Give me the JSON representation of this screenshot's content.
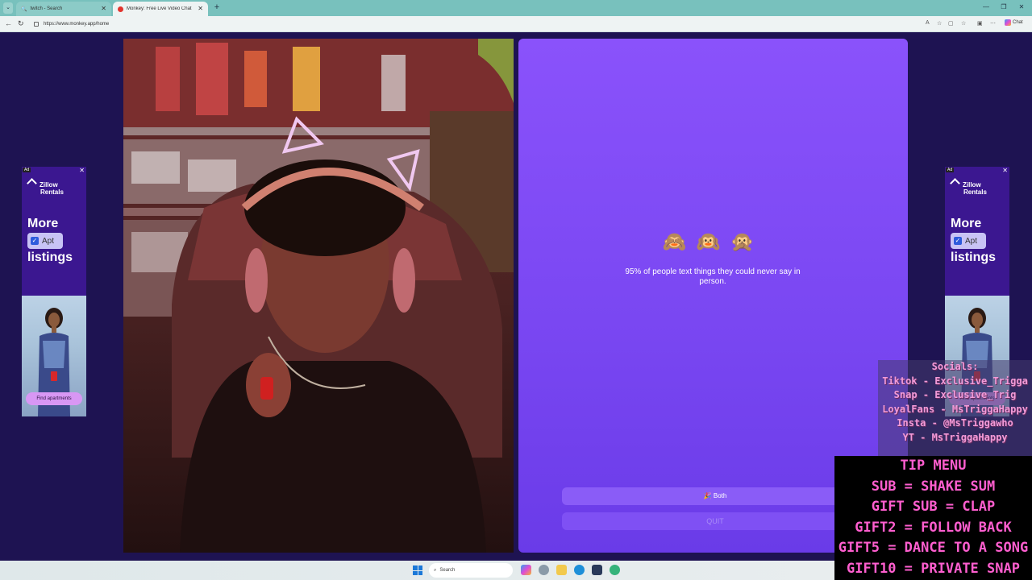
{
  "browser": {
    "tabs": [
      {
        "title": "twitch - Search",
        "active": false
      },
      {
        "title": "Monkey: Free Live Video Chat",
        "active": true
      }
    ],
    "url": "https://www.monkey.app/home",
    "chat_label": "Chat"
  },
  "ads": {
    "label": "Ad",
    "brand_line1": "Zillow",
    "brand_line2": "Rentals",
    "more": "More",
    "apt": "Apt",
    "listings": "listings",
    "cta": "Find apartments"
  },
  "chat": {
    "emojis": "🙈🙉🙊",
    "fact": "95% of people text things they could never say in person.",
    "both_label": "🎉 Both",
    "quit_label": "QUIT"
  },
  "overlay": {
    "socials": [
      "Socials:",
      "Tiktok - Exclusive_Trigga",
      "Snap - Exclusive_Trig",
      "LoyalFans - MsTriggaHappy",
      "Insta - @MsTriggawho",
      "YT - MsTriggaHappy"
    ],
    "tip_menu": [
      "TIP MENU",
      "SUB = SHAKE SUM",
      "GIFT SUB = CLAP",
      "GIFT2 = FOLLOW BACK",
      "GIFT5 = DANCE TO A SONG",
      "GIFT10 = PRIVATE SNAP"
    ]
  },
  "taskbar": {
    "search_placeholder": "Search"
  }
}
